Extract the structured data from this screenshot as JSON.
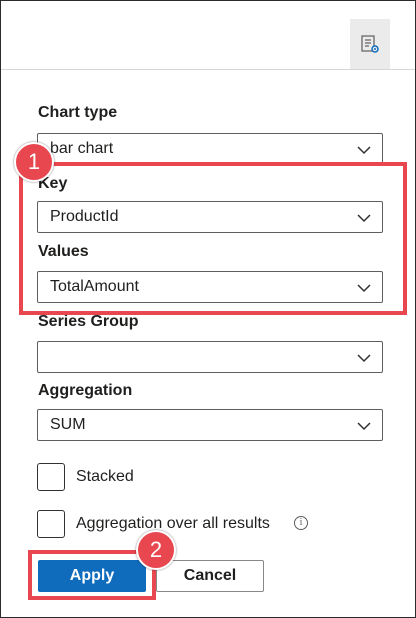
{
  "toolbar": {
    "settings_icon": "chart-settings-icon"
  },
  "fields": {
    "chart_type": {
      "label": "Chart type",
      "value": "bar chart"
    },
    "key": {
      "label": "Key",
      "value": "ProductId"
    },
    "values": {
      "label": "Values",
      "value": "TotalAmount"
    },
    "series_group": {
      "label": "Series Group",
      "value": ""
    },
    "aggregation": {
      "label": "Aggregation",
      "value": "SUM"
    }
  },
  "options": {
    "stacked": {
      "label": "Stacked",
      "checked": false
    },
    "aggregation_all": {
      "label": "Aggregation over all results",
      "checked": false
    }
  },
  "buttons": {
    "apply": "Apply",
    "cancel": "Cancel"
  },
  "annotations": {
    "callout_1": "1",
    "callout_2": "2",
    "highlight_color": "#e8474f"
  },
  "colors": {
    "primary": "#0f6cbd"
  }
}
